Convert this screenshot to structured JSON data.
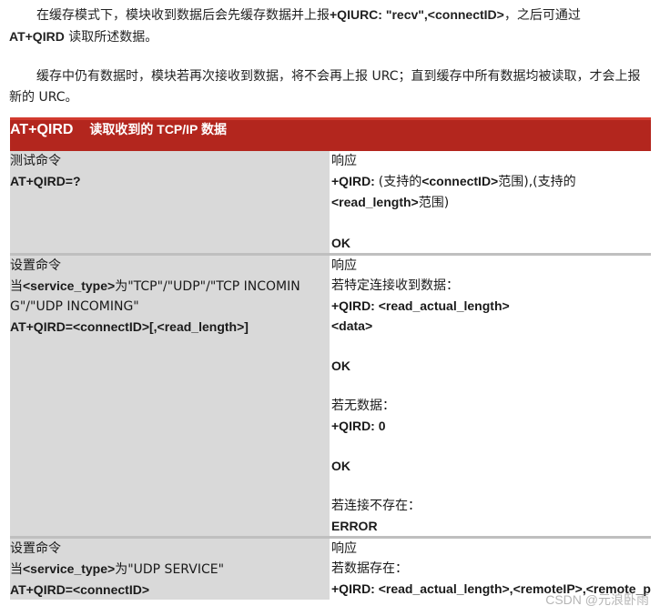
{
  "intro": {
    "p1_a": "在缓存模式下，模块收到数据后会先缓存数据并上报",
    "p1_b": "+QIURC: \"recv\",<connectID>",
    "p1_c": "，之后可通过",
    "p1_d": "AT+QIRD",
    "p1_e": " 读取所述数据。",
    "p2": "缓存中仍有数据时，模块若再次接收到数据，将不会再上报 URC；直到缓存中所有数据均被读取，才会上报新的 URC。"
  },
  "table": {
    "header": {
      "name": "AT+QIRD",
      "title": "读取收到的 TCP/IP 数据"
    },
    "rows": [
      {
        "left": {
          "label": "测试命令",
          "command": "AT+QIRD=?"
        },
        "right": {
          "response_label": "响应",
          "r1_a": "+QIRD: ",
          "r1_b": "(支持的",
          "r1_c": "<connectID>",
          "r1_d": "范围),(支持的",
          "r1_e": "<read_length>",
          "r1_f": "范围)",
          "ok": "OK"
        }
      },
      {
        "left": {
          "label": "设置命令",
          "cond_a": "当",
          "cond_b": "<service_type>",
          "cond_c": "为\"TCP\"/\"UDP\"/\"TCP INCOMING\"/\"UDP INCOMING\"",
          "command": "AT+QIRD=<connectID>[,<read_length>]"
        },
        "right": {
          "response_label": "响应",
          "case1": "若特定连接收到数据：",
          "qird": "+QIRD: <read_actual_length>",
          "data": "<data>",
          "ok1": "OK",
          "case2": "若无数据：",
          "qird0": "+QIRD: 0",
          "ok2": "OK",
          "case3": "若连接不存在：",
          "error": "ERROR"
        }
      },
      {
        "left": {
          "label": "设置命令",
          "cond_a": "当",
          "cond_b": "<service_type>",
          "cond_c": "为\"UDP SERVICE\"",
          "command": "AT+QIRD=<connectID>"
        },
        "right": {
          "response_label": "响应",
          "case1": "若数据存在：",
          "qird": "+QIRD: <read_actual_length>,<remoteIP>,<remote_port>"
        }
      }
    ]
  },
  "watermark": "CSDN @元浪卧雨",
  "colors": {
    "header_bg": "#b3261e",
    "left_cell_bg": "#d9d9d9"
  }
}
